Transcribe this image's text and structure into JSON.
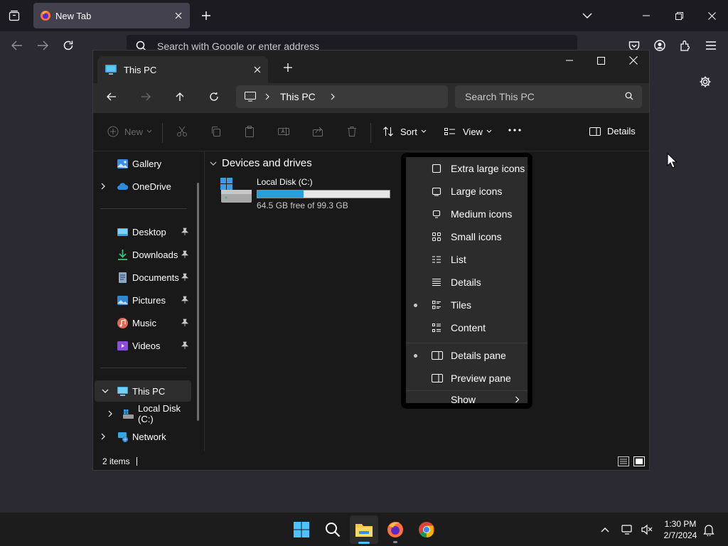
{
  "browser": {
    "tab_title": "New Tab",
    "url_placeholder": "Search with Google or enter address"
  },
  "explorer": {
    "tab_title": "This PC",
    "breadcrumb": "This PC",
    "search_placeholder": "Search This PC",
    "toolbar": {
      "new": "New",
      "sort": "Sort",
      "view": "View",
      "details": "Details"
    },
    "nav": {
      "gallery": "Gallery",
      "onedrive": "OneDrive",
      "desktop": "Desktop",
      "downloads": "Downloads",
      "documents": "Documents",
      "pictures": "Pictures",
      "music": "Music",
      "videos": "Videos",
      "this_pc": "This PC",
      "local_disk": "Local Disk (C:)",
      "network": "Network"
    },
    "group_title": "Devices and drives",
    "drive": {
      "name": "Local Disk (C:)",
      "free_text": "64.5 GB free of 99.3 GB",
      "used_fraction": 0.35
    },
    "status": "2 items"
  },
  "view_menu": {
    "items": [
      {
        "label": "Extra large icons",
        "checked": false
      },
      {
        "label": "Large icons",
        "checked": false
      },
      {
        "label": "Medium icons",
        "checked": false
      },
      {
        "label": "Small icons",
        "checked": false
      },
      {
        "label": "List",
        "checked": false
      },
      {
        "label": "Details",
        "checked": false
      },
      {
        "label": "Tiles",
        "checked": true
      },
      {
        "label": "Content",
        "checked": false
      }
    ],
    "panes": [
      {
        "label": "Details pane",
        "checked": true
      },
      {
        "label": "Preview pane",
        "checked": false
      }
    ],
    "show": "Show"
  },
  "taskbar": {
    "time": "1:30 PM",
    "date": "2/7/2024"
  },
  "colors": {
    "accent": "#4cc2ff",
    "drive_fill": "#26a0da"
  }
}
